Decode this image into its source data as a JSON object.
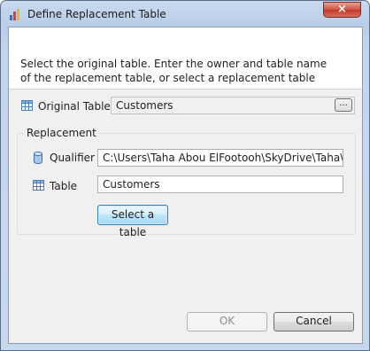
{
  "window": {
    "title": "Define Replacement Table",
    "app_icon": "crystal-reports-icon",
    "close_label": "×"
  },
  "instructions": {
    "line1": "Select the original table. Enter the owner and table name",
    "line2": "of the replacement table, or select a replacement table"
  },
  "original_table": {
    "label": "Original Table",
    "icon": "table-icon",
    "value": "Customers",
    "browse_label": "..."
  },
  "replacement": {
    "group_label": "Replacement",
    "qualifier_label": "Qualifier",
    "qualifier_icon": "database-icon",
    "qualifier_value": "C:\\Users\\Taha Abou ElFootooh\\SkyDrive\\Taha\\Pac",
    "table_label": "Table",
    "table_icon": "table-icon",
    "table_value": "Customers",
    "select_button": "Select a table"
  },
  "buttons": {
    "ok": "OK",
    "cancel": "Cancel"
  },
  "colors": {
    "title_bar": "#b9cde8",
    "close_button": "#c0392b",
    "focused_button": "#bee6fd"
  }
}
